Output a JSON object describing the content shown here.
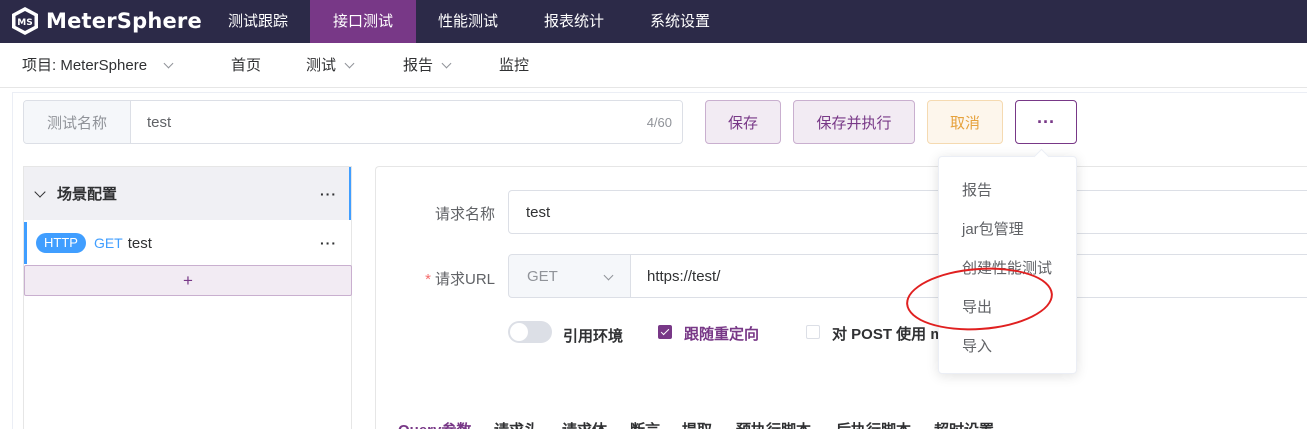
{
  "app": {
    "name": "MeterSphere"
  },
  "topnav": {
    "items": [
      {
        "label": "测试跟踪",
        "active": false
      },
      {
        "label": "接口测试",
        "active": true
      },
      {
        "label": "性能测试",
        "active": false
      },
      {
        "label": "报表统计",
        "active": false
      },
      {
        "label": "系统设置",
        "active": false
      }
    ]
  },
  "subnav": {
    "project": "项目: MeterSphere",
    "items": [
      "首页",
      "测试",
      "报告",
      "监控"
    ]
  },
  "test_name": {
    "label": "测试名称",
    "value": "test",
    "count": "4/60"
  },
  "actions": {
    "save": "保存",
    "save_run": "保存并执行",
    "cancel": "取消",
    "more": "···"
  },
  "scenario": {
    "title": "场景配置",
    "more": "···",
    "add": "+",
    "requests": [
      {
        "protocol": "HTTP",
        "method": "GET",
        "name": "test",
        "more": "···"
      }
    ]
  },
  "request": {
    "name_label": "请求名称",
    "name_value": "test",
    "url_required": "*",
    "url_label": "请求URL",
    "method": "GET",
    "url_value": "https://test/",
    "options": {
      "env_label": "引用环境",
      "env_on": false,
      "redirect_label": "跟随重定向",
      "redirect_checked": true,
      "post_label": "对 POST 使用 m",
      "post_checked": false
    },
    "tabs": [
      "Query参数",
      "请求头",
      "请求体",
      "断言",
      "提取",
      "预执行脚本",
      "后执行脚本",
      "超时设置"
    ]
  },
  "dropdown_menu": {
    "items": [
      "报告",
      "jar包管理",
      "创建性能测试",
      "导出",
      "导入"
    ]
  },
  "colors": {
    "navbar": "#2c2a48",
    "accent": "#783887",
    "http_badge": "#409eff",
    "cancel": "#e6a23c",
    "annotation": "#e02020"
  }
}
